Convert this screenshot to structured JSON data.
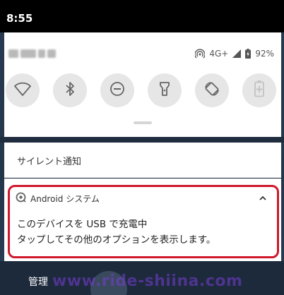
{
  "status_bar": {
    "time": "8:55"
  },
  "quick_settings": {
    "network": "4G+",
    "battery": "92%",
    "tiles": [
      {
        "icon": "wifi-icon"
      },
      {
        "icon": "bluetooth-icon"
      },
      {
        "icon": "do-not-disturb-icon"
      },
      {
        "icon": "flashlight-icon"
      },
      {
        "icon": "auto-rotate-icon"
      },
      {
        "icon": "battery-saver-icon"
      }
    ]
  },
  "silent_section": {
    "label": "サイレント通知"
  },
  "notification": {
    "app_name": "Android システム",
    "title": "このデバイスを USB で充電中",
    "text": "タップしてその他のオプションを表示します。"
  },
  "bottom": {
    "manage_label": "管理",
    "watermark": "www.ride-shiina.com"
  },
  "colors": {
    "highlight": "#d0172b",
    "panel": "#ffffff",
    "background": "#1c2a3c"
  }
}
